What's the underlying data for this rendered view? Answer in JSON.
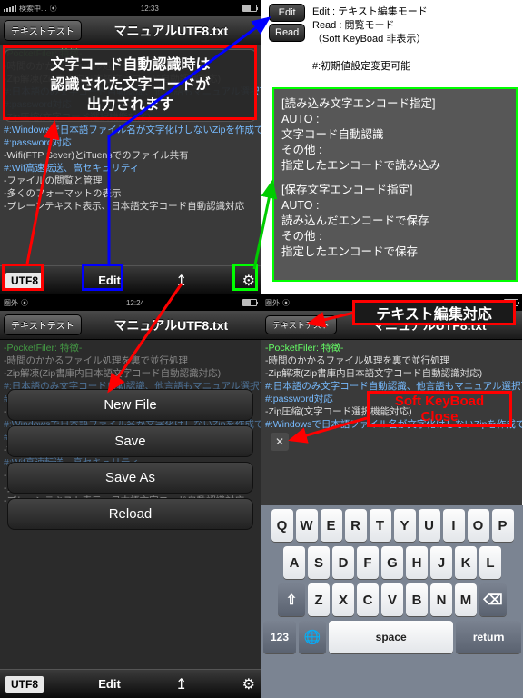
{
  "statusbar": {
    "left": "検索中...",
    "right": "圏外",
    "time": "12:33",
    "time2": "12:24",
    "wifi": "⦿"
  },
  "nav": {
    "back": "テキストテスト",
    "title": "マニュアルUTF8.txt",
    "title_short": "テキス… マ…"
  },
  "popup": {
    "l1": "文字コード自動認識時は",
    "l2": "認識された文字コードが",
    "l3": "出力されます"
  },
  "doc": {
    "l0": "-PocketFiler: 特徴-",
    "l1": "-時間のかかるファイル処理を裏で並行処理",
    "l2": "-Zip解凍(Zip書庫内日本語文字コード自動認識対応)",
    "l3": "#:日本語のみ文字コード自動認識、他言語もマニュアル選択可能",
    "l4": "#:password対応",
    "l5": "-Zip圧縮(文字コード選択機能対応)",
    "l6": "#:Windowsで日本語ファイル名が文字化けしないZipを作成できます",
    "l7": "#:password対応",
    "l8": "-Wifi(FTP Sever)とiTuensでのファイル共有",
    "l9": "#:Wif高速転送、高セキュリティ",
    "l10": "-ファイルの閲覧と管理",
    "l11": "-多くのフォーマットの表示",
    "l12": "-プレーンテキスト表示、日本語文字コード自動認識対応"
  },
  "toolbar": {
    "enc": "UTF8",
    "mode": "Edit",
    "share": "↥",
    "gear": "⚙"
  },
  "sheet": {
    "b1": "New File",
    "b2": "Save",
    "b3": "Save As",
    "b4": "Reload"
  },
  "editread": {
    "edit": "Edit",
    "read": "Read"
  },
  "annotRight": {
    "l1": "Edit  : テキスト編集モード",
    "l2": "Read : 閲覧モード",
    "l3": "（Soft KeyBoad 非表示）",
    "l4": "#:初期値設定変更可能"
  },
  "greenbox": {
    "t1": "[読み込み文字エンコード指定]",
    "t2": "AUTO :",
    "t3": "文字コード自動認識",
    "t4": "その他 :",
    "t5": "指定したエンコードで読み込み",
    "t6": "",
    "t7": "[保存文字エンコード指定]",
    "t8": "AUTO :",
    "t9": "読み込んだエンコードで保存",
    "t10": "その他 :",
    "t11": "指定したエンコードで保存"
  },
  "titleBox": "テキスト編集対応",
  "softClose": "Soft KeyBoad\nClose",
  "kbd": {
    "r1": [
      "Q",
      "W",
      "E",
      "R",
      "T",
      "Y",
      "U",
      "I",
      "O",
      "P"
    ],
    "r2": [
      "A",
      "S",
      "D",
      "F",
      "G",
      "H",
      "J",
      "K",
      "L"
    ],
    "shift": "⇧",
    "del": "⌫",
    "r3": [
      "Z",
      "X",
      "C",
      "V",
      "B",
      "N",
      "M"
    ],
    "n123": "123",
    "globe": "🌐",
    "space": "space",
    "ret": "return"
  },
  "closeX": "✕"
}
